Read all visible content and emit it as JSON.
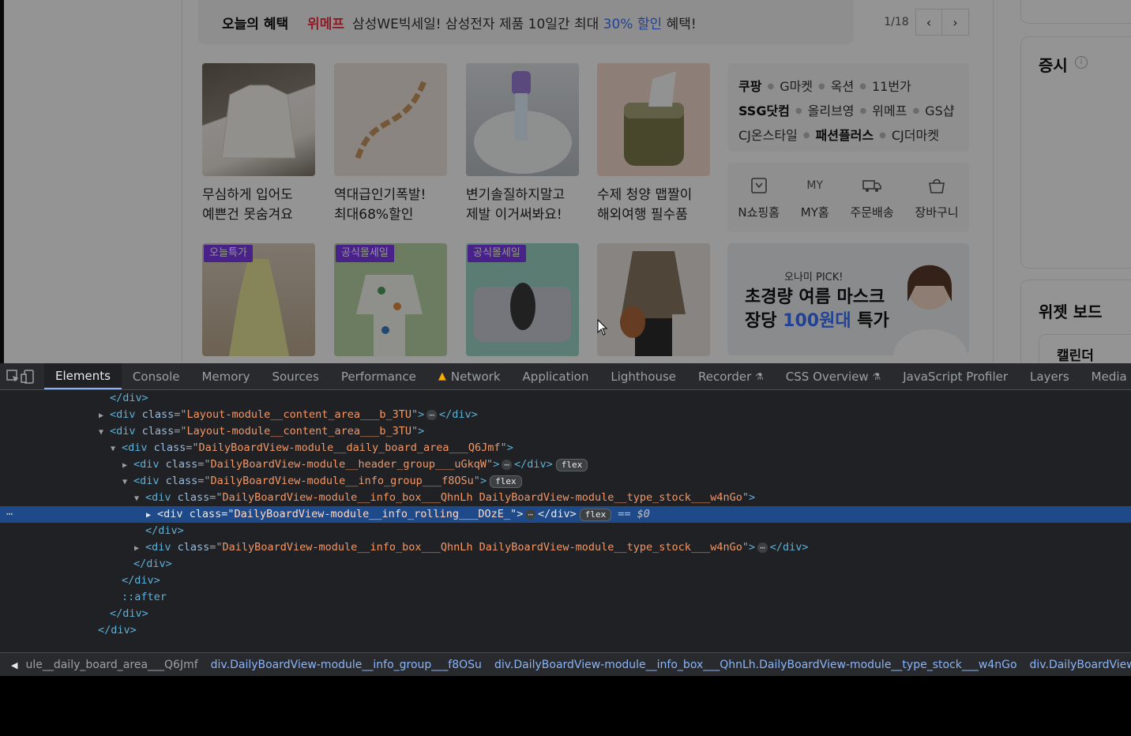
{
  "page": {
    "benefit": {
      "title": "오늘의 혜택",
      "brand": "위메프",
      "text_before": "삼성WE빅세일! 삼성전자 제품 10일간 최대",
      "highlight": "30% 할인",
      "text_after": "혜택!",
      "page_count": "1/18",
      "prev_icon": "‹",
      "next_icon": "›"
    },
    "products": [
      {
        "caption": "무심하게 입어도\n예쁜건 못숨겨요",
        "badge": ""
      },
      {
        "caption": "역대급인기폭발!\n최대68%할인",
        "badge": ""
      },
      {
        "caption": "변기솔질하지말고\n제발 이거써봐요!",
        "badge": ""
      },
      {
        "caption": "수제 청양 맵짤이\n해외여행 필수품",
        "badge": ""
      },
      {
        "caption": "",
        "badge": "오늘특가"
      },
      {
        "caption": "",
        "badge": "공식몰세일"
      },
      {
        "caption": "",
        "badge": "공식몰세일"
      },
      {
        "caption": "",
        "badge": ""
      }
    ],
    "shops": {
      "row1": [
        "쿠팡",
        "G마켓",
        "옥션",
        "11번가"
      ],
      "row2": [
        "SSG닷컴",
        "올리브영",
        "위메프",
        "GS샵"
      ],
      "row3": [
        "CJ온스타일",
        "패션플러스",
        "CJ더마켓"
      ]
    },
    "quick_links": [
      {
        "label": "N쇼핑홈",
        "icon_text": ""
      },
      {
        "label": "MY홈",
        "icon_text": "MY"
      },
      {
        "label": "주문배송",
        "icon_text": ""
      },
      {
        "label": "장바구니",
        "icon_text": ""
      }
    ],
    "banner": {
      "small": "오나미 PICK!",
      "line1": "초경량 여름 마스크",
      "line2_before": "장당",
      "line2_highlight": "100원대",
      "line2_after": "특가"
    },
    "right_column": {
      "stock_title": "증시",
      "widget_title": "위젯 보드",
      "calendar_title": "캘린더"
    }
  },
  "devtools": {
    "tabs": [
      "Elements",
      "Console",
      "Memory",
      "Sources",
      "Performance",
      "Network",
      "Application",
      "Lighthouse",
      "Recorder",
      "CSS Overview",
      "JavaScript Profiler",
      "Layers",
      "Media"
    ],
    "active_tab": "Elements",
    "flex_label": "flex",
    "ellipsis": "⋯",
    "selected_marker": "== $0",
    "dom_lines": {
      "l1": "</div>",
      "l2_class": "Layout-module__content_area___b_3TU",
      "l3_class": "Layout-module__content_area___b_3TU",
      "l4_class": "DailyBoardView-module__daily_board_area___Q6Jmf",
      "l5_class": "DailyBoardView-module__header_group___uGkqW",
      "l6_class": "DailyBoardView-module__info_group___f8OSu",
      "l7_class": "DailyBoardView-module__info_box___QhnLh DailyBoardView-module__type_stock___w4nGo",
      "l8_class": "DailyBoardView-module__info_rolling___DOzE_",
      "l9": "</div>",
      "l10_class": "DailyBoardView-module__info_box___QhnLh DailyBoardView-module__type_stock___w4nGo",
      "l11": "</div>",
      "l12": "</div>",
      "l13": "::after",
      "l14": "</div>",
      "l15": "</div>"
    },
    "breadcrumbs": [
      "ule__daily_board_area___Q6Jmf",
      "div.DailyBoardView-module__info_group___f8OSu",
      "div.DailyBoardView-module__info_box___QhnLh.DailyBoardView-module__type_stock___w4nGo",
      "div.DailyBoardView-module__inf"
    ]
  },
  "colors": {
    "accent_blue": "#3a72ff",
    "brand_red": "#f43142",
    "devtools_bg": "#202124",
    "selection": "#1f4a8a"
  }
}
